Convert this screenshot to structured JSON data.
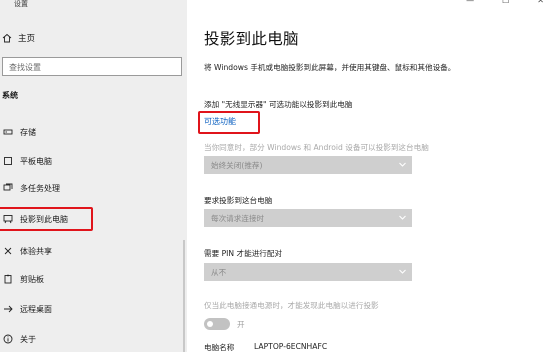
{
  "window": {
    "title": "设置",
    "controls": [
      "—",
      "☐",
      "✕"
    ]
  },
  "sidebar": {
    "home_label": "主页",
    "search_placeholder": "查找设置",
    "section_label": "系统",
    "items": [
      {
        "label": "存储",
        "icon": "storage-icon"
      },
      {
        "label": "平板电脑",
        "icon": "tablet-icon"
      },
      {
        "label": "多任务处理",
        "icon": "multitasking-icon"
      },
      {
        "label": "投影到此电脑",
        "icon": "project-icon",
        "active": true
      },
      {
        "label": "体验共享",
        "icon": "shared-experiences-icon"
      },
      {
        "label": "剪贴板",
        "icon": "clipboard-icon"
      },
      {
        "label": "远程桌面",
        "icon": "remote-desktop-icon"
      },
      {
        "label": "关于",
        "icon": "info-icon"
      }
    ]
  },
  "main": {
    "title": "投影到此电脑",
    "description": "将 Windows 手机或电脑投影到此屏幕，并使用其键盘、鼠标和其他设备。",
    "add_display_text": "添加 \"无线显示器\" 可选功能以投影到此电脑",
    "optional_features_link": "可选功能",
    "setting1_label": "当你同意时，部分 Windows 和 Android 设备可以投影到这台电脑",
    "setting1_value": "始终关闭(推荐)",
    "setting2_label": "要求投影到这台电脑",
    "setting2_value": "每次请求连接时",
    "setting3_label": "需要 PIN 才能进行配对",
    "setting3_value": "从不",
    "setting4_label": "仅当此电脑接通电源时，才能发现此电脑以进行投影",
    "toggle_state": "开",
    "pc_name_label": "电脑名称",
    "pc_name_value": "LAPTOP-6ECNHAFC"
  },
  "colors": {
    "accent_link": "#0a5fc0",
    "highlight_outline": "#e0141b",
    "sidebar_bg": "#eeeeee"
  }
}
